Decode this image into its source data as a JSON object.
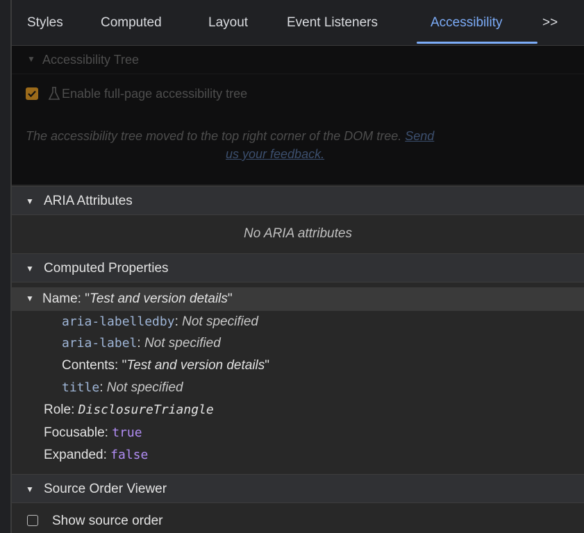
{
  "tabs": {
    "styles": "Styles",
    "computed": "Computed",
    "layout": "Layout",
    "event_listeners": "Event Listeners",
    "accessibility": "Accessibility",
    "more": ">>"
  },
  "a11y_tree": {
    "header": "Accessibility Tree",
    "checkbox_label": "Enable full-page accessibility tree",
    "message": "The accessibility tree moved to the top right corner of the DOM tree.",
    "link_part1": "Send",
    "link_part2": "us your feedback."
  },
  "aria": {
    "header": "ARIA Attributes",
    "empty": "No ARIA attributes"
  },
  "computed": {
    "header": "Computed Properties",
    "name_label": "Name: \"",
    "name_value": "Test and version details",
    "quote": "\"",
    "labelledby_key": "aria-labelledby",
    "labelledby_value": "Not specified",
    "label_key": "aria-label",
    "label_value": "Not specified",
    "contents_label": "Contents: \"",
    "contents_value": "Test and version details",
    "title_key": "title",
    "title_value": "Not specified",
    "role_label": "Role: ",
    "role_value": "DisclosureTriangle",
    "focusable_label": "Focusable: ",
    "focusable_value": "true",
    "expanded_label": "Expanded: ",
    "expanded_value": "false"
  },
  "source_order": {
    "header": "Source Order Viewer",
    "checkbox_label": "Show source order"
  }
}
